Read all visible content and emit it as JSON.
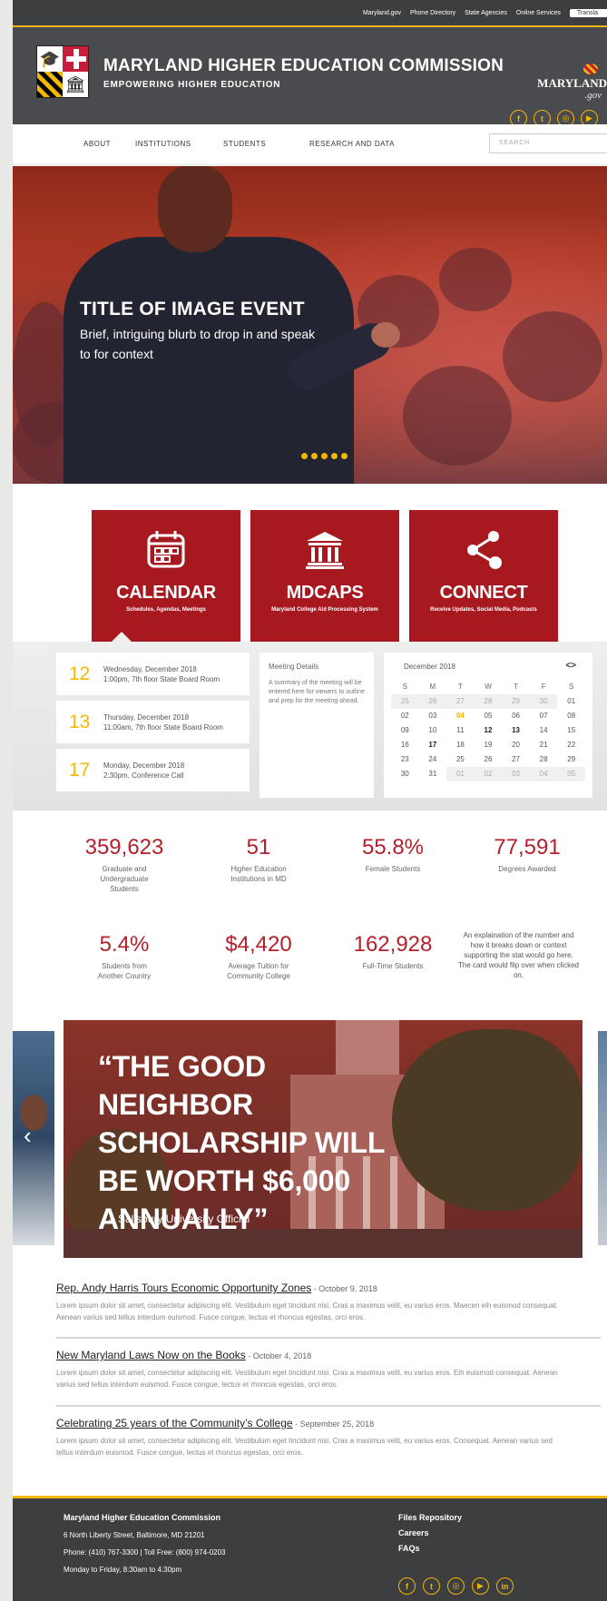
{
  "utility": {
    "links": [
      "Maryland.gov",
      "Phone Directory",
      "State Agencies",
      "Online Services"
    ],
    "translate": "Transla"
  },
  "header": {
    "title": "MARYLAND HIGHER EDUCATION COMMISSION",
    "subtitle": "EMPOWERING HIGHER EDUCATION",
    "md_word": "MARYLAND",
    "gov_word": ".gov"
  },
  "nav": {
    "items": [
      "ABOUT",
      "INSTITUTIONS",
      "STUDENTS",
      "RESEARCH AND DATA"
    ],
    "search_placeholder": "SEARCH"
  },
  "hero": {
    "title": "TITLE OF IMAGE EVENT",
    "blurb": "Brief, intriguing blurb to drop in and speak to for context",
    "slide_count": 5
  },
  "cards": [
    {
      "title": "CALENDAR",
      "subtitle": "Schedules, Agendas, Meetings",
      "icon": "calendar-icon"
    },
    {
      "title": "MDCAPS",
      "subtitle": "Maryland College Aid Processing System",
      "icon": "building-icon"
    },
    {
      "title": "CONNECT",
      "subtitle": "Receive Updates, Social Media, Podcasts",
      "icon": "share-icon"
    }
  ],
  "events": [
    {
      "day": "12",
      "line1": "Wednesday, December 2018",
      "line2": "1:00pm, 7th floor State Board Room"
    },
    {
      "day": "13",
      "line1": "Thursday, December 2018",
      "line2": "11:00am, 7th floor State Board Room"
    },
    {
      "day": "17",
      "line1": "Monday, December 2018",
      "line2": "2:30pm, Conference Call"
    }
  ],
  "meeting": {
    "heading": "Meeting Details",
    "body": "A summary of the meeting will be entered here for viewers to outline and prep for the meeting ahead."
  },
  "calendar": {
    "month": "December 2018",
    "nav": "<>",
    "weekdays": [
      "S",
      "M",
      "T",
      "W",
      "T",
      "F",
      "S"
    ],
    "weeks": [
      [
        "25",
        "26",
        "27",
        "28",
        "29",
        "30",
        "01"
      ],
      [
        "02",
        "03",
        "04",
        "05",
        "06",
        "07",
        "08"
      ],
      [
        "09",
        "10",
        "11",
        "12",
        "13",
        "14",
        "15"
      ],
      [
        "16",
        "17",
        "18",
        "19",
        "20",
        "21",
        "22"
      ],
      [
        "23",
        "24",
        "25",
        "26",
        "27",
        "28",
        "29"
      ],
      [
        "30",
        "31",
        "01",
        "02",
        "03",
        "04",
        "05"
      ]
    ]
  },
  "stats": [
    {
      "value": "359,623",
      "label": "Graduate and Undergraduate Students"
    },
    {
      "value": "51",
      "label": "Higher Education Institutions in MD"
    },
    {
      "value": "55.8%",
      "label": "Female Students"
    },
    {
      "value": "77,591",
      "label": "Degrees Awarded"
    },
    {
      "value": "5.4%",
      "label": "Students from Another Country"
    },
    {
      "value": "$4,420",
      "label": "Average Tuition  for Community College"
    },
    {
      "value": "162,928",
      "label": "Full-Time Students"
    }
  ],
  "stat_note": "An explaination of the number and how it breaks down or context supporting the stat would go here. The card would flip over when clicked on.",
  "quote": {
    "text": "“THE GOOD NEIGHBOR SCHOLARSHIP WILL BE WORTH $6,000 ANNUALLY”",
    "attribution": "– Salisbury University Official",
    "prev_arrow": "‹"
  },
  "news": [
    {
      "title": "Rep. Andy Harris Tours Economic Opportunity Zones",
      "date": " - October 9, 2018",
      "body": "Lorem ipsum dolor sit amet, consectetur adipiscing elit. Vestibulum eget tincidunt nisi. Cras a maximus velit, eu varius eros. Maecen eih euismod consequat. Aenean varius sed tellus interdum euismod. Fusce congue, lectus et rhoncus egestas, orci eros."
    },
    {
      "title": "New Maryland Laws Now on the Books",
      "date": " - October 4, 2018",
      "body": "Lorem ipsum dolor sit amet, consectetur adipiscing elit. Vestibulum eget tincidunt nisi. Cras a maximus velit, eu varius eros. Eih euismod consequat. Aenean varius sed tellus interdum euismod. Fusce congue, lectus et rhoncus egestas, orci eros."
    },
    {
      "title": "Celebrating 25 years of the Community’s College",
      "date": " - September 25, 2018",
      "body": "Lorem ipsum dolor sit amet, consectetur adipiscing elit. Vestibulum eget tincidunt nisi. Cras a maximus velit, eu varius eros. Consequat. Aenean varius sed tellus interdum euismod. Fusce congue, lectus et rhoncus egestas, orci eros."
    }
  ],
  "footer": {
    "org": "Maryland Higher Education Commission",
    "address": "6 North Liberty Street, Baltimore, MD 21201",
    "phone": "Phone: (410) 767-3300   |   Toll Free: (800) 974-0203",
    "hours": "Monday to Friday, 8:30am to 4:30pm",
    "links": [
      "Files Repository",
      "Careers",
      "FAQs"
    ]
  },
  "colors": {
    "accent": "#f2b705",
    "brand_red": "#a8191f",
    "dark": "#3d3e40"
  }
}
